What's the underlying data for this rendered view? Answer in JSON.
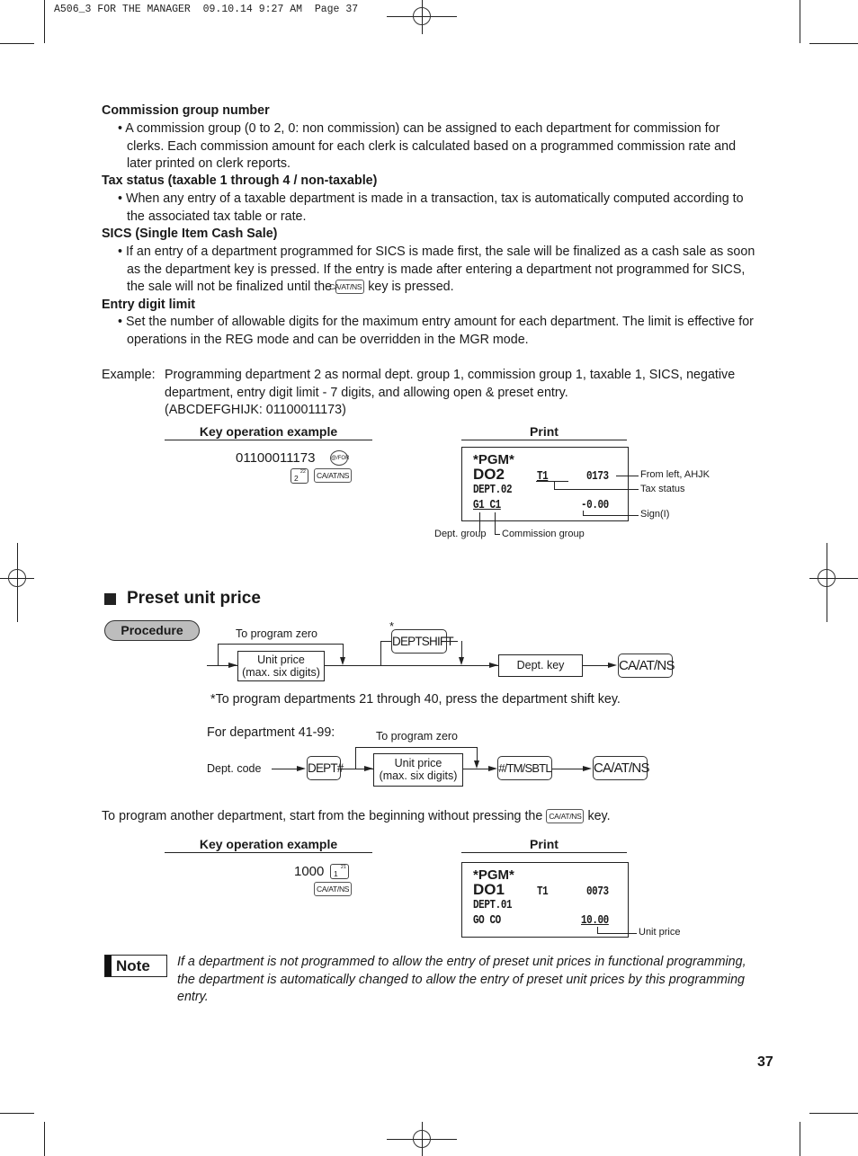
{
  "print_header": "A506_3 FOR THE MANAGER  09.10.14 9:27 AM  Page 37",
  "sections": {
    "commission": {
      "title": "Commission group number",
      "bullet": "• A commission group (0 to 2, 0: non commission) can be assigned to each department for commission for clerks.  Each commission amount for each clerk is calculated based on a programmed commission rate and later printed on clerk reports."
    },
    "tax": {
      "title": "Tax status (taxable 1 through 4 / non-taxable)",
      "bullet": "• When any entry of a taxable department is made in a transaction, tax is automatically computed according to the associated tax table or rate."
    },
    "sics": {
      "title": "SICS (Single Item Cash Sale)",
      "bullet_before": "• If an entry of a department programmed for SICS is made first, the sale will be finalized as a cash sale as soon as the department key is pressed.  If the entry is made after entering a department not programmed for SICS, the sale will not be finalized until the ",
      "bullet_key": "CA/AT/NS",
      "bullet_after": " key is pressed."
    },
    "digit_limit": {
      "title": "Entry digit limit",
      "bullet": "• Set the number of allowable digits for the maximum entry amount for each department.  The limit is effective for operations in the REG mode and can be overridden in the MGR mode."
    }
  },
  "example": {
    "label": "Example:",
    "line1": "Programming department 2 as normal dept. group 1, commission group 1, taxable 1, SICS, negative",
    "line2": "department, entry digit limit - 7 digits, and allowing open & preset entry.",
    "line3": "(ABCDEFGHIJK: 01100011173)"
  },
  "example1": {
    "key_op_heading": "Key operation example",
    "print_heading": "Print",
    "key_entry": "01100011173",
    "key_at_for": "@/FOR",
    "key_dept_main": "2",
    "key_dept_sup": "22",
    "key_ca": "CA/AT/NS",
    "receipt": {
      "line1": "*PGM*",
      "line2_left": "DO2",
      "line2_mid": "T1",
      "line2_right": "0173",
      "line3": "DEPT.02",
      "line4_left": "G1 C1",
      "line4_right": "-0.00"
    },
    "callouts": {
      "ahjk": "From left, AHJK",
      "tax": "Tax status",
      "sign": "Sign(I)",
      "dept_group": "Dept. group",
      "commission_group": "Commission group"
    }
  },
  "preset": {
    "title": "Preset unit price",
    "procedure_badge": "Procedure",
    "flow1": {
      "zero_label": "To program zero",
      "unit_price_line1": "Unit price",
      "unit_price_line2": "(max. six digits)",
      "asterisk": "*",
      "deptshift_key": "DEPTSHIFT",
      "dept_key": "Dept. key",
      "ca_key": "CA/AT/NS"
    },
    "footnote": "*To program departments 21 through 40, press the department shift key.",
    "flow2": {
      "heading": "For department 41-99:",
      "zero_label": "To program zero",
      "dept_code": "Dept. code",
      "dept_hash_key": "DEPT#",
      "unit_price_line1": "Unit price",
      "unit_price_line2": "(max. six digits)",
      "sbtl_key": "#/TM/SBTL",
      "ca_key": "CA/AT/NS"
    },
    "another_before": "To program another department, start from the beginning without pressing the ",
    "another_key": "CA/AT/NS",
    "another_after": " key."
  },
  "example2": {
    "key_op_heading": "Key operation example",
    "print_heading": "Print",
    "key_entry": "1000",
    "key_dept_main": "1",
    "key_dept_sup": "21",
    "key_ca": "CA/AT/NS",
    "receipt": {
      "line1": "*PGM*",
      "line2_left": "DO1",
      "line2_mid": "T1",
      "line2_right": "0073",
      "line3": "DEPT.01",
      "line4_left": "GO CO",
      "line4_right": "10.00"
    },
    "callouts": {
      "unit_price": "Unit price"
    }
  },
  "note": {
    "label": "Note",
    "text": "If a department is not programmed to allow the entry of preset unit prices in functional programming, the department is automatically changed to allow the entry of preset unit prices by this programming entry."
  },
  "page_number": "37"
}
